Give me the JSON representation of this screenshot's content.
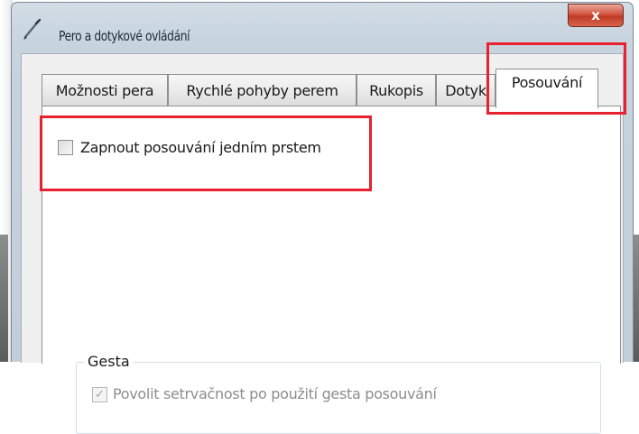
{
  "window": {
    "title": "Pero a dotykové ovládání",
    "close_label": "x"
  },
  "tabs": [
    {
      "label": "Možnosti pera",
      "active": false
    },
    {
      "label": "Rychlé pohyby perem",
      "active": false
    },
    {
      "label": "Rukopis",
      "active": false
    },
    {
      "label": "Dotyk",
      "active": false
    },
    {
      "label": "Posouvání",
      "active": true
    }
  ],
  "page": {
    "single_finger_checkbox": {
      "label": "Zapnout posouvání jedním prstem",
      "checked": false
    },
    "gestures": {
      "legend": "Gesta",
      "inertia_checkbox": {
        "label": "Povolit setrvačnost po použití gesta posouvání",
        "checked": true,
        "disabled": true
      }
    }
  },
  "colors": {
    "highlight": "#e8212e",
    "close_button": "#c03a25"
  },
  "icons": {
    "app": "pen-icon",
    "close": "close-icon"
  }
}
